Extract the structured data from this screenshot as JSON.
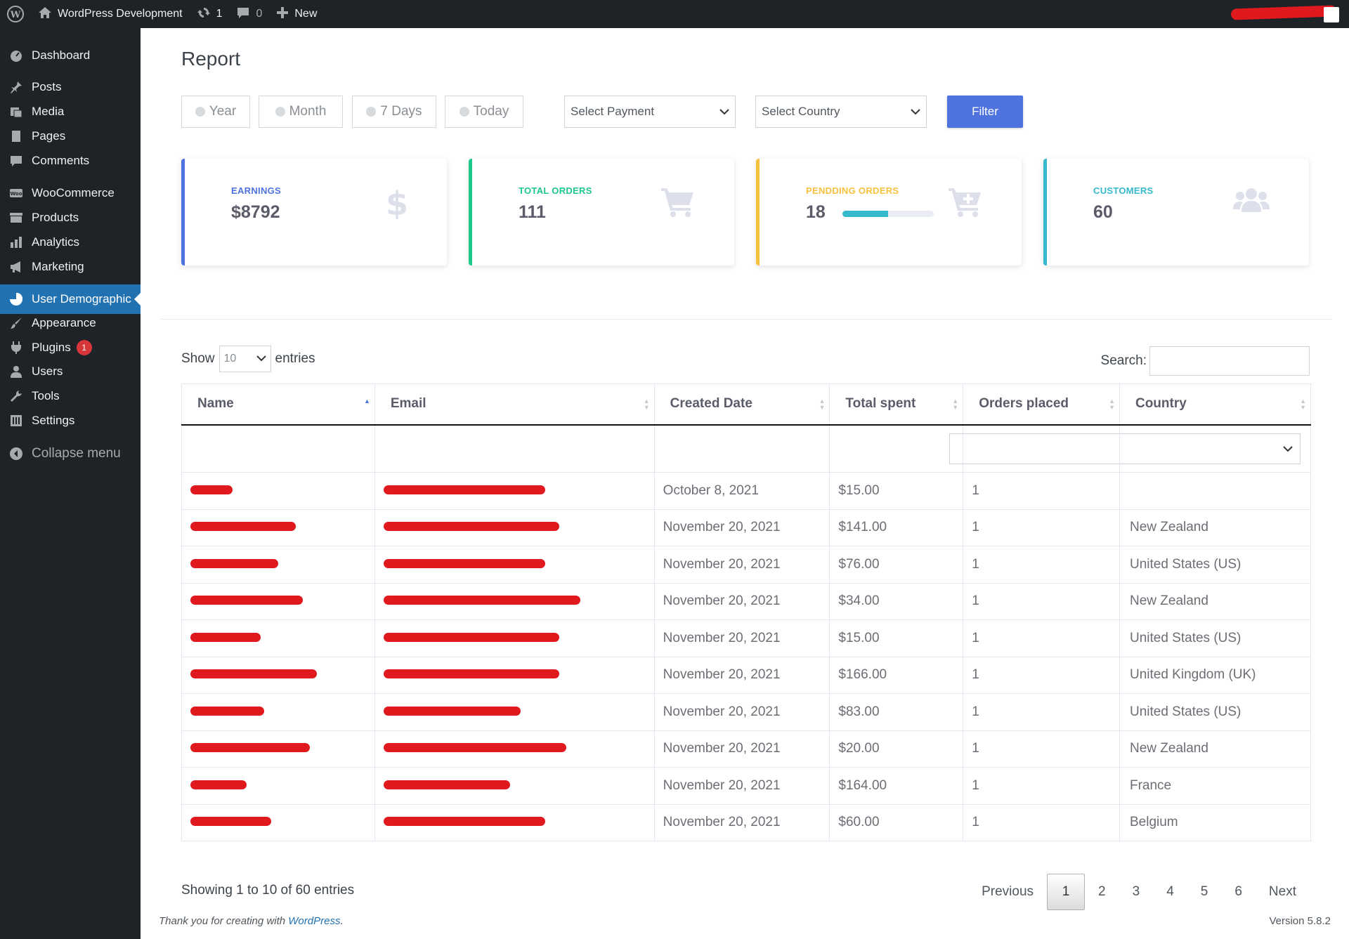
{
  "admin_bar": {
    "site_name": "WordPress Development",
    "updates_count": "1",
    "comments_count": "0",
    "new_label": "New"
  },
  "sidebar": {
    "items": [
      {
        "label": "Dashboard",
        "icon": "dashboard-icon"
      },
      {
        "label": "Posts",
        "icon": "pin-icon"
      },
      {
        "label": "Media",
        "icon": "media-icon"
      },
      {
        "label": "Pages",
        "icon": "page-icon"
      },
      {
        "label": "Comments",
        "icon": "comment-icon"
      },
      {
        "label": "WooCommerce",
        "icon": "woo-icon"
      },
      {
        "label": "Products",
        "icon": "archive-icon"
      },
      {
        "label": "Analytics",
        "icon": "bar-chart-icon"
      },
      {
        "label": "Marketing",
        "icon": "megaphone-icon"
      },
      {
        "label": "User Demographic",
        "icon": "pie-chart-icon",
        "active": true
      },
      {
        "label": "Appearance",
        "icon": "brush-icon"
      },
      {
        "label": "Plugins",
        "icon": "plugin-icon",
        "badge": "1"
      },
      {
        "label": "Users",
        "icon": "user-icon"
      },
      {
        "label": "Tools",
        "icon": "wrench-icon"
      },
      {
        "label": "Settings",
        "icon": "settings-icon"
      }
    ],
    "collapse_label": "Collapse menu"
  },
  "report": {
    "title": "Report",
    "periods": [
      "Year",
      "Month",
      "7 Days",
      "Today"
    ],
    "payment_select": "Select Payment",
    "country_select": "Select Country",
    "filter_label": "Filter"
  },
  "cards": [
    {
      "label": "EARNINGS",
      "value": "$8792",
      "color": "#4e73df",
      "icon": "dollar-icon"
    },
    {
      "label": "TOTAL ORDERS",
      "value": "111",
      "color": "#1cc88a",
      "icon": "cart-icon"
    },
    {
      "label": "PENDDING ORDERS",
      "value": "18",
      "color": "#f6c23e",
      "icon": "cart-plus-icon",
      "progress": 0.5
    },
    {
      "label": "CUSTOMERS",
      "value": "60",
      "color": "#36b9cc",
      "icon": "users-icon"
    }
  ],
  "table": {
    "show_label": "Show",
    "entries_label": "entries",
    "page_length": "10",
    "search_label": "Search:",
    "columns": [
      "Name",
      "Email",
      "Created Date",
      "Total spent",
      "Orders placed",
      "Country"
    ],
    "rows": [
      {
        "date": "October 8, 2021",
        "total": "$15.00",
        "orders": "1",
        "country": ""
      },
      {
        "date": "November 20, 2021",
        "total": "$141.00",
        "orders": "1",
        "country": "New Zealand"
      },
      {
        "date": "November 20, 2021",
        "total": "$76.00",
        "orders": "1",
        "country": "United States (US)"
      },
      {
        "date": "November 20, 2021",
        "total": "$34.00",
        "orders": "1",
        "country": "New Zealand"
      },
      {
        "date": "November 20, 2021",
        "total": "$15.00",
        "orders": "1",
        "country": "United States (US)"
      },
      {
        "date": "November 20, 2021",
        "total": "$166.00",
        "orders": "1",
        "country": "United Kingdom (UK)"
      },
      {
        "date": "November 20, 2021",
        "total": "$83.00",
        "orders": "1",
        "country": "United States (US)"
      },
      {
        "date": "November 20, 2021",
        "total": "$20.00",
        "orders": "1",
        "country": "New Zealand"
      },
      {
        "date": "November 20, 2021",
        "total": "$164.00",
        "orders": "1",
        "country": "France"
      },
      {
        "date": "November 20, 2021",
        "total": "$60.00",
        "orders": "1",
        "country": "Belgium"
      }
    ],
    "info": "Showing 1 to 10 of 60 entries",
    "pagination": {
      "previous": "Previous",
      "pages": [
        "1",
        "2",
        "3",
        "4",
        "5",
        "6"
      ],
      "current": "1",
      "next": "Next"
    }
  },
  "footer": {
    "thanks_prefix": "Thank you for creating with",
    "thanks_link": "WordPress",
    "thanks_suffix": ".",
    "version": "Version 5.8.2"
  }
}
